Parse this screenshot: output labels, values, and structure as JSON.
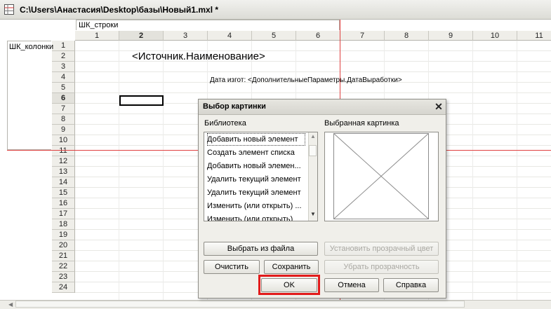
{
  "window": {
    "title": "C:\\Users\\Анастасия\\Desktop\\базы\\Новый1.mxl *"
  },
  "sheet": {
    "rows_area_label": "ШК_строки",
    "cols_area_label": "ШК_колонки",
    "columns": [
      "1",
      "2",
      "3",
      "4",
      "5",
      "6",
      "7",
      "8",
      "9",
      "10",
      "11"
    ],
    "active_column": "2",
    "rows": [
      "1",
      "2",
      "3",
      "4",
      "5",
      "6",
      "7",
      "8",
      "9",
      "10",
      "11",
      "12",
      "13",
      "14",
      "15",
      "16",
      "17",
      "18",
      "19",
      "20",
      "21",
      "22",
      "23",
      "24"
    ],
    "active_row": "6",
    "cell_title": "<Источник.Наименование>",
    "cell_date": "Дата изгот:  <ДополнительныеПараметры.ДатаВыработки>"
  },
  "dialog": {
    "title": "Выбор картинки",
    "close_glyph": "✕",
    "library_label": "Библиотека",
    "selected_label": "Выбранная картинка",
    "library_items": [
      "Добавить новый элемент",
      "Создать элемент списка",
      "Добавить новый элемен...",
      "Удалить текущий элемент",
      "Удалить текущий элемент",
      "Изменить (или открыть) ...",
      "Изменить (или открыть)"
    ],
    "buttons": {
      "choose_file": "Выбрать из файла",
      "set_transparent": "Установить прозрачный цвет",
      "clear": "Очистить",
      "save": "Сохранить",
      "remove_transparency": "Убрать прозрачность",
      "ok": "OK",
      "cancel": "Отмена",
      "help": "Справка"
    }
  }
}
